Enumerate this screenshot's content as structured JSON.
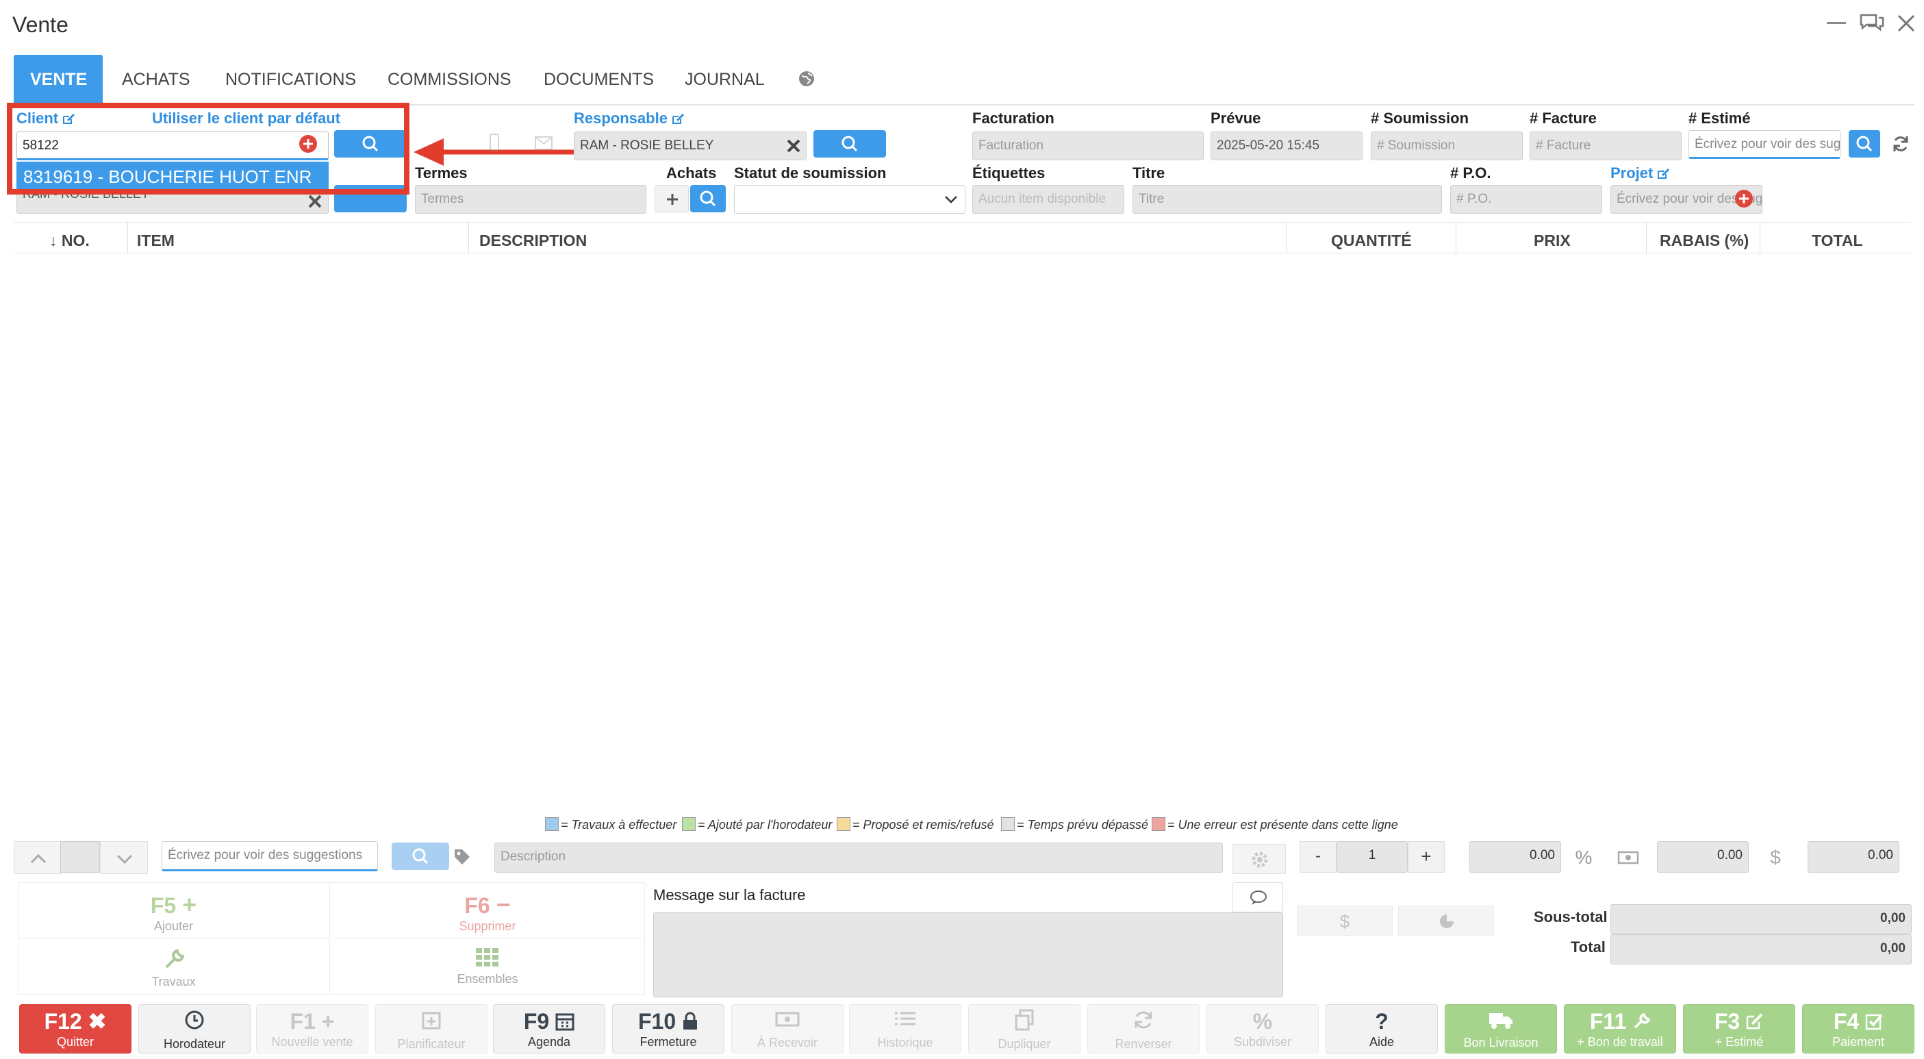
{
  "window": {
    "title": "Vente"
  },
  "tabs": [
    "VENTE",
    "ACHATS",
    "NOTIFICATIONS",
    "COMMISSIONS",
    "DOCUMENTS",
    "JOURNAL"
  ],
  "client": {
    "label": "Client",
    "default_link": "Utiliser le client par défaut",
    "input_value": "58122",
    "suggestion": "8319619 - BOUCHERIE HUOT ENR",
    "hidden_value": "RAM - ROSIE BELLEY"
  },
  "responsable": {
    "label": "Responsable",
    "value": "RAM - ROSIE BELLEY"
  },
  "termes": {
    "label": "Termes",
    "placeholder": "Termes"
  },
  "achats": {
    "label": "Achats"
  },
  "statut": {
    "label": "Statut de soumission"
  },
  "facturation": {
    "label": "Facturation",
    "placeholder": "Facturation"
  },
  "prevue": {
    "label": "Prévue",
    "value": "2025-05-20 15:45"
  },
  "soumission": {
    "label": "# Soumission",
    "placeholder": "# Soumission"
  },
  "facture": {
    "label": "# Facture",
    "placeholder": "# Facture"
  },
  "estime": {
    "label": "# Estimé",
    "placeholder": "Écrivez pour voir des suggestions"
  },
  "etiquettes": {
    "label": "Étiquettes",
    "placeholder": "Aucun item disponible"
  },
  "titre": {
    "label": "Titre",
    "placeholder": "Titre"
  },
  "po": {
    "label": "# P.O.",
    "placeholder": "# P.O."
  },
  "projet": {
    "label": "Projet",
    "placeholder": "Écrivez pour voir des suggestions"
  },
  "table": {
    "columns": [
      "↓ NO.",
      "ITEM",
      "DESCRIPTION",
      "QUANTITÉ",
      "PRIX",
      "RABAIS (%)",
      "TOTAL"
    ]
  },
  "legend": [
    {
      "color": "#9fcbee",
      "text": "= Travaux à effectuer"
    },
    {
      "color": "#bfe0a4",
      "text": "= Ajouté par l'horodateur"
    },
    {
      "color": "#f5dc9a",
      "text": "= Proposé et remis/refusé"
    },
    {
      "color": "#e3e3e3",
      "text": "= Temps prévu dépassé"
    },
    {
      "color": "#f0a39f",
      "text": "= Une erreur est présente dans cette ligne"
    }
  ],
  "entry": {
    "suggest_placeholder": "Écrivez pour voir des suggestions",
    "description_placeholder": "Description",
    "quantity": "1",
    "price": "0.00",
    "discount": "0.00",
    "total": "0.00"
  },
  "actions": {
    "f5_key": "F5",
    "f5_label": "Ajouter",
    "f6_key": "F6",
    "f6_label": "Supprimer",
    "travaux_label": "Travaux",
    "ensembles_label": "Ensembles"
  },
  "message": {
    "label": "Message sur la facture"
  },
  "totals": {
    "subtotal_label": "Sous-total",
    "subtotal_value": "0,00",
    "total_label": "Total",
    "total_value": "0,00"
  },
  "footer": [
    {
      "key": "F12",
      "label": "Quitter"
    },
    {
      "key": "",
      "label": "Horodateur"
    },
    {
      "key": "F1",
      "label": "Nouvelle vente"
    },
    {
      "key": "",
      "label": "Planificateur"
    },
    {
      "key": "F9",
      "label": "Agenda"
    },
    {
      "key": "F10",
      "label": "Fermeture"
    },
    {
      "key": "",
      "label": "À Recevoir"
    },
    {
      "key": "",
      "label": "Historique"
    },
    {
      "key": "",
      "label": "Dupliquer"
    },
    {
      "key": "",
      "label": "Renverser"
    },
    {
      "key": "",
      "label": "Subdiviser"
    },
    {
      "key": "?",
      "label": "Aide"
    },
    {
      "key": "",
      "label": "Bon Livraison"
    },
    {
      "key": "F11",
      "label": "+ Bon de travail"
    },
    {
      "key": "F3",
      "label": "+ Estimé"
    },
    {
      "key": "F4",
      "label": "Paiement"
    }
  ],
  "colors": {
    "accent": "#3d9be9",
    "annotation_red": "#e13c2c",
    "quit_red": "#e04841",
    "green": "#a7d48d"
  }
}
